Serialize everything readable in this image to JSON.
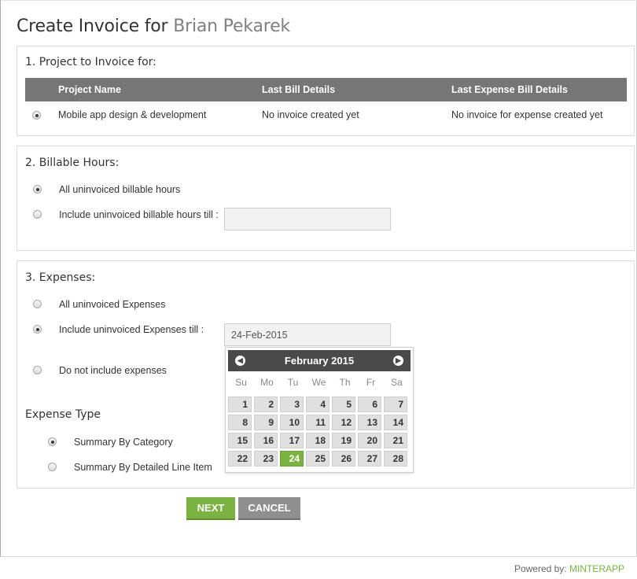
{
  "title": {
    "prefix": "Create Invoice for",
    "client": "Brian Pekarek"
  },
  "project_section": {
    "title": "1. Project to Invoice for:",
    "columns": [
      "Project Name",
      "Last Bill Details",
      "Last Expense Bill Details"
    ],
    "rows": [
      {
        "selected": true,
        "name": "Mobile app design & development",
        "last_bill": "No invoice created yet",
        "last_expense_bill": "No invoice for expense created yet"
      }
    ]
  },
  "billable_section": {
    "title": "2. Billable Hours:",
    "options": [
      {
        "label": "All uninvoiced billable hours",
        "selected": true
      },
      {
        "label": "Include uninvoiced billable hours till :",
        "selected": false
      }
    ],
    "till_date_value": ""
  },
  "expenses_section": {
    "title": "3. Expenses:",
    "options": [
      {
        "label": "All uninvoiced Expenses",
        "selected": false
      },
      {
        "label": "Include uninvoiced Expenses till :",
        "selected": true
      },
      {
        "label": "Do not include expenses",
        "selected": false
      }
    ],
    "till_date_value": "24-Feb-2015",
    "expense_type_title": "Expense Type",
    "expense_types": [
      {
        "label": "Summary By Category",
        "selected": true
      },
      {
        "label": "Summary By Detailed Line Item",
        "selected": false
      }
    ]
  },
  "calendar": {
    "month_label": "February 2015",
    "weekdays": [
      "Su",
      "Mo",
      "Tu",
      "We",
      "Th",
      "Fr",
      "Sa"
    ],
    "weeks": [
      [
        "1",
        "2",
        "3",
        "4",
        "5",
        "6",
        "7"
      ],
      [
        "8",
        "9",
        "10",
        "11",
        "12",
        "13",
        "14"
      ],
      [
        "15",
        "16",
        "17",
        "18",
        "19",
        "20",
        "21"
      ],
      [
        "22",
        "23",
        "24",
        "25",
        "26",
        "27",
        "28"
      ]
    ],
    "selected_day": "24",
    "prev_icon": "chevron-left-icon",
    "next_icon": "chevron-right-icon"
  },
  "buttons": {
    "next": "NEXT",
    "cancel": "CANCEL"
  },
  "footer": {
    "prefix": "Powered by:",
    "brand": "MINTERAPP"
  },
  "colors": {
    "accent": "#7ab342",
    "table_header": "#767676",
    "calendar_header": "#4a4a4a",
    "cancel": "#8f8f8f"
  }
}
